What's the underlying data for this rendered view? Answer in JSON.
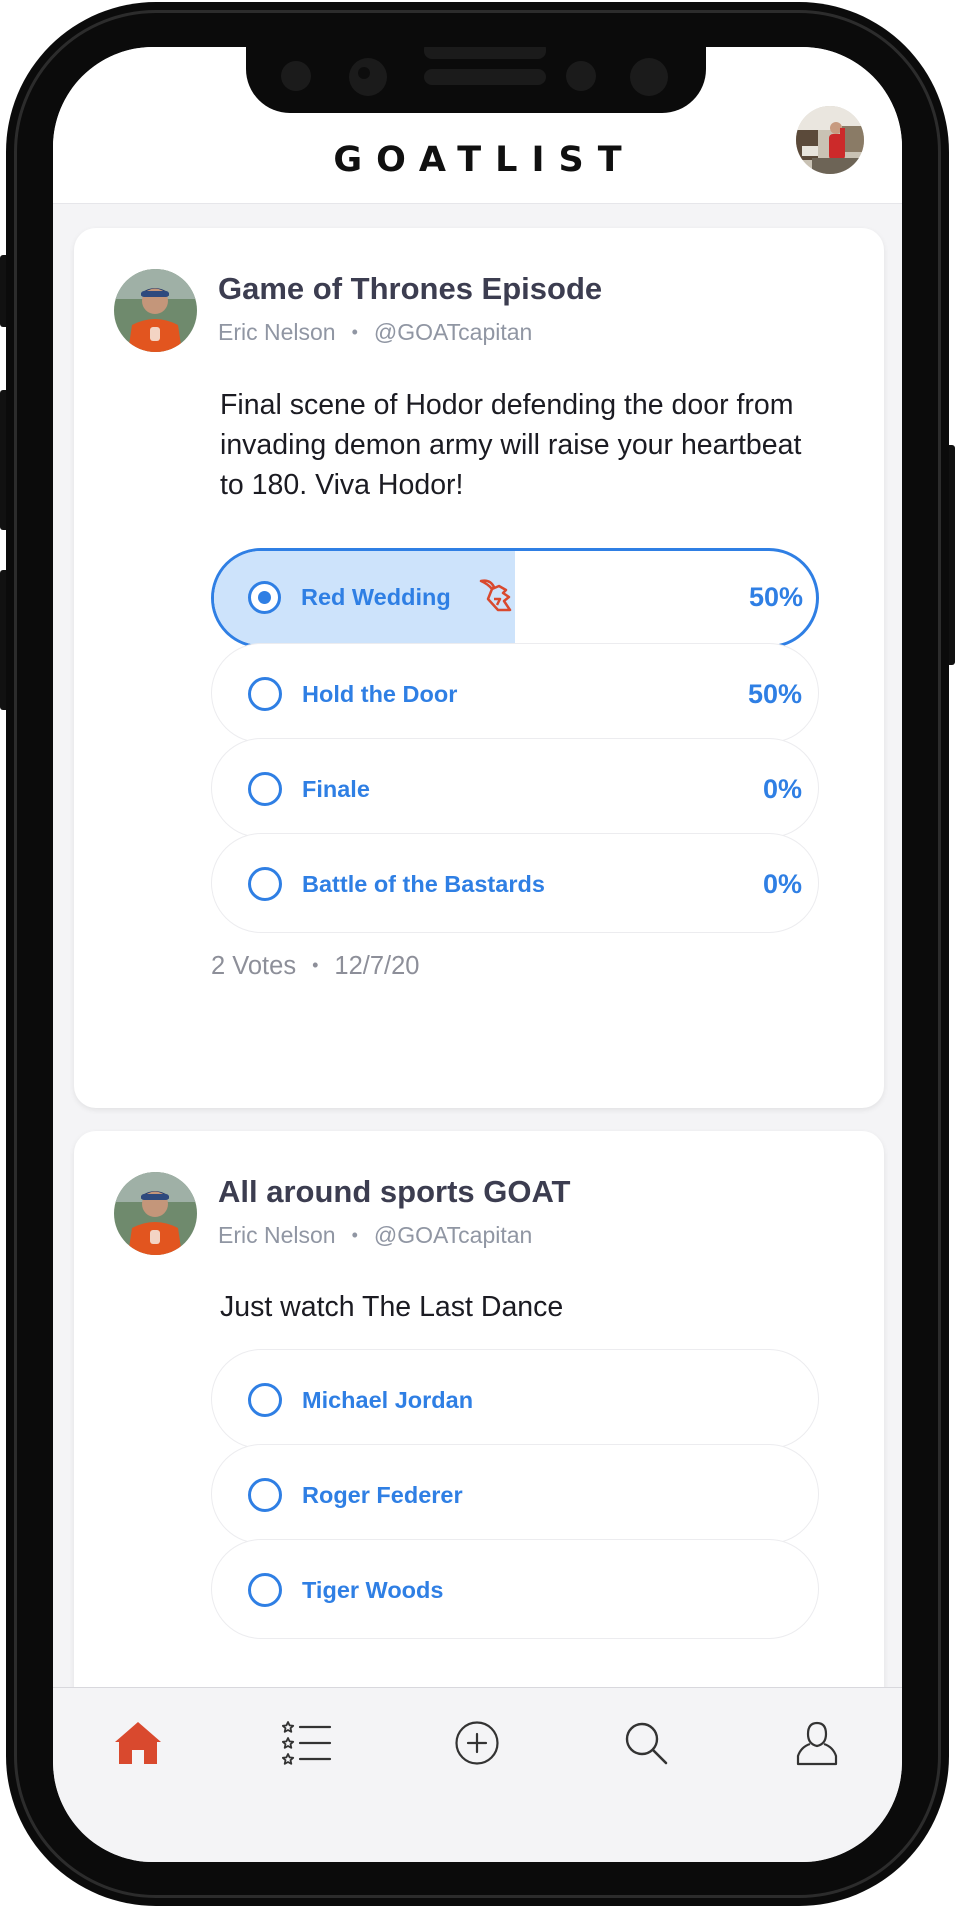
{
  "app": {
    "title": "GOATLIST"
  },
  "posts": [
    {
      "title": "Game of Thrones Episode",
      "author": "Eric Nelson",
      "handle": "@GOATcapitan",
      "body": "Final scene of Hodor defending the door from invading demon army will raise your heartbeat to 180. Viva Hodor!",
      "options": [
        {
          "label": "Red Wedding",
          "percent": "50%",
          "share": 0.5,
          "selected": true
        },
        {
          "label": "Hold the Door",
          "percent": "50%",
          "share": 0.5,
          "selected": false
        },
        {
          "label": "Finale",
          "percent": "0%",
          "share": 0,
          "selected": false
        },
        {
          "label": "Battle of the Bastards",
          "percent": "0%",
          "share": 0,
          "selected": false
        }
      ],
      "votes": "2 Votes",
      "date": "12/7/20"
    },
    {
      "title": "All around sports GOAT",
      "author": "Eric Nelson",
      "handle": "@GOATcapitan",
      "body": "Just watch The Last Dance",
      "options": [
        {
          "label": "Michael Jordan"
        },
        {
          "label": "Roger Federer"
        },
        {
          "label": "Tiger Woods"
        }
      ]
    }
  ],
  "tabs": [
    {
      "name": "home",
      "icon": "home-icon",
      "active": true
    },
    {
      "name": "lists",
      "icon": "star-list-icon"
    },
    {
      "name": "create",
      "icon": "plus-circle-icon"
    },
    {
      "name": "search",
      "icon": "search-icon"
    },
    {
      "name": "profile",
      "icon": "user-icon"
    }
  ],
  "colors": {
    "accent": "#2f7fe4",
    "active_tab": "#d9492e",
    "selected_fill": "#cde3fb",
    "title_text": "#3c3d50",
    "meta_text": "#8d8f99"
  }
}
